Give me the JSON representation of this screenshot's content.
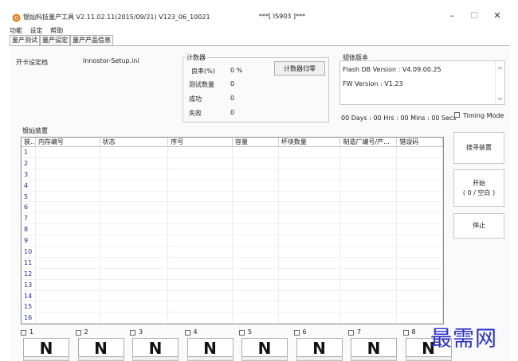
{
  "window": {
    "title": "银灿科技量产工具 V2.11.02.11(2015/09/21)   V123_06_10021",
    "center_title": "***[ IS903 ]***",
    "minimize": "–",
    "maximize": "☐",
    "close": "✕"
  },
  "menu": [
    "功能",
    "设定",
    "帮助"
  ],
  "tabs": [
    "量产测试",
    "量产设定",
    "量产产品信息"
  ],
  "settings_file": {
    "label": "开卡设定档",
    "value": "Innostor-Setup.ini"
  },
  "counter": {
    "title": "计数器",
    "rows": [
      {
        "label": "良率(%)",
        "value": "0 %"
      },
      {
        "label": "测试数量",
        "value": "0"
      },
      {
        "label": "成功",
        "value": "0"
      },
      {
        "label": "失败",
        "value": "0"
      }
    ],
    "reset_button": "计数器归零"
  },
  "firmware": {
    "title": "韧体版本",
    "flash_db": "Flash DB Version :  V4.09.00.25",
    "fw": "FW Version :  V1.23"
  },
  "elapsed": "00 Days : 00 Hrs : 00 Mins : 00 Secs",
  "timing_mode": "Timing Mode",
  "devices": {
    "title": "银灿装置",
    "columns": [
      "装...",
      "内存编号",
      "状态",
      "序号",
      "容量",
      "坏块数量",
      "制造厂编号/产...",
      "错误码"
    ],
    "rows": [
      "1",
      "2",
      "3",
      "4",
      "5",
      "6",
      "7",
      "8",
      "9",
      "10",
      "11",
      "12",
      "13",
      "14",
      "15",
      "16"
    ]
  },
  "side_buttons": {
    "search": "搜寻装置",
    "start_line1": "开始",
    "start_line2": "( 0 / 空白 )",
    "stop": "停止"
  },
  "ports": [
    {
      "num": "1",
      "status": "N"
    },
    {
      "num": "2",
      "status": "N"
    },
    {
      "num": "3",
      "status": "N"
    },
    {
      "num": "4",
      "status": "N"
    },
    {
      "num": "5",
      "status": "N"
    },
    {
      "num": "6",
      "status": "N"
    },
    {
      "num": "7",
      "status": "N"
    },
    {
      "num": "8",
      "status": "N"
    }
  ],
  "watermark": "最需网",
  "colors": {
    "row_number": "#1a2db0",
    "watermark": "#2a2fd0",
    "icon_outer": "#e8820c"
  }
}
